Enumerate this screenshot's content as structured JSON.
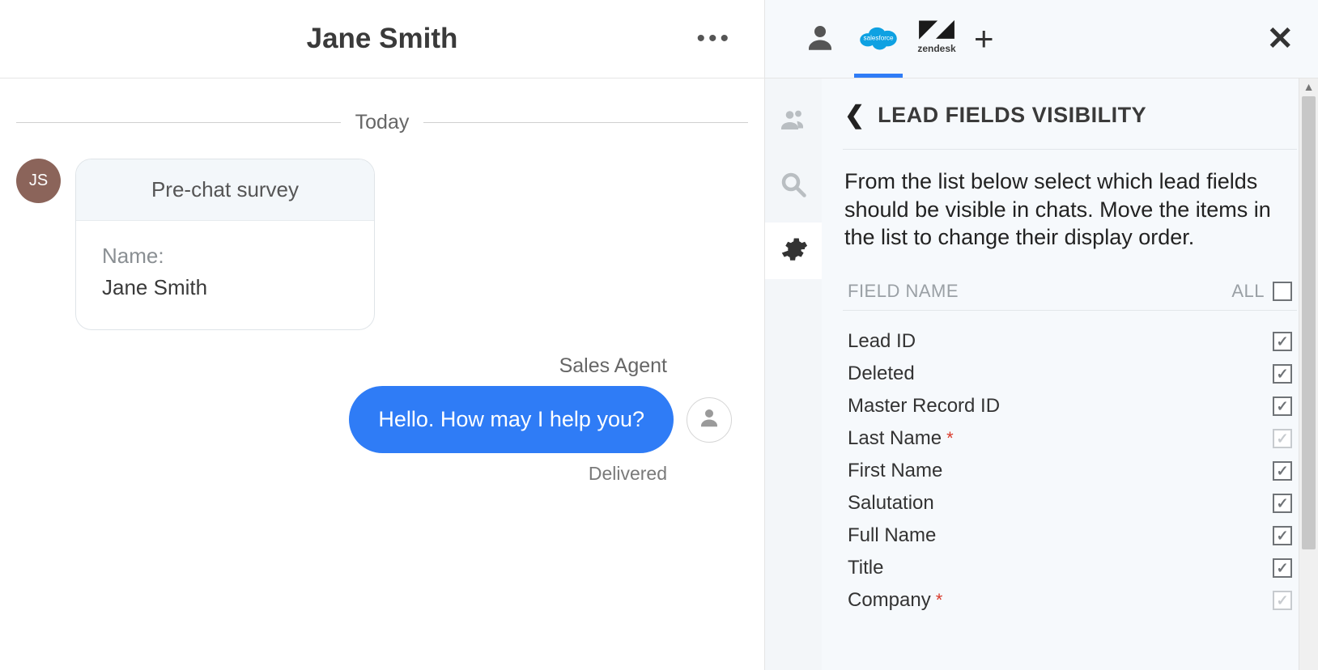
{
  "chat": {
    "contact_name": "Jane Smith",
    "contact_initials": "JS",
    "date_label": "Today",
    "prechat_title": "Pre-chat survey",
    "prechat_field_label": "Name:",
    "prechat_field_value": "Jane Smith",
    "agent_display_name": "Sales Agent",
    "agent_message": "Hello. How may I help you?",
    "delivered_label": "Delivered"
  },
  "right": {
    "integrations": {
      "salesforce_label": "salesforce",
      "zendesk_label": "zendesk"
    },
    "section_title": "LEAD FIELDS VISIBILITY",
    "instructions": "From the list below select which lead fields should be visible in chats. Move the items in the list to change their display order.",
    "table": {
      "field_name_header": "FIELD NAME",
      "all_label": "ALL",
      "all_checked": false
    },
    "fields": [
      {
        "label": "Lead ID",
        "required": false,
        "checked": true,
        "disabled": false
      },
      {
        "label": "Deleted",
        "required": false,
        "checked": true,
        "disabled": false
      },
      {
        "label": "Master Record ID",
        "required": false,
        "checked": true,
        "disabled": false
      },
      {
        "label": "Last Name",
        "required": true,
        "checked": true,
        "disabled": true
      },
      {
        "label": "First Name",
        "required": false,
        "checked": true,
        "disabled": false
      },
      {
        "label": "Salutation",
        "required": false,
        "checked": true,
        "disabled": false
      },
      {
        "label": "Full Name",
        "required": false,
        "checked": true,
        "disabled": false
      },
      {
        "label": "Title",
        "required": false,
        "checked": true,
        "disabled": false
      },
      {
        "label": "Company",
        "required": true,
        "checked": true,
        "disabled": true
      }
    ]
  }
}
